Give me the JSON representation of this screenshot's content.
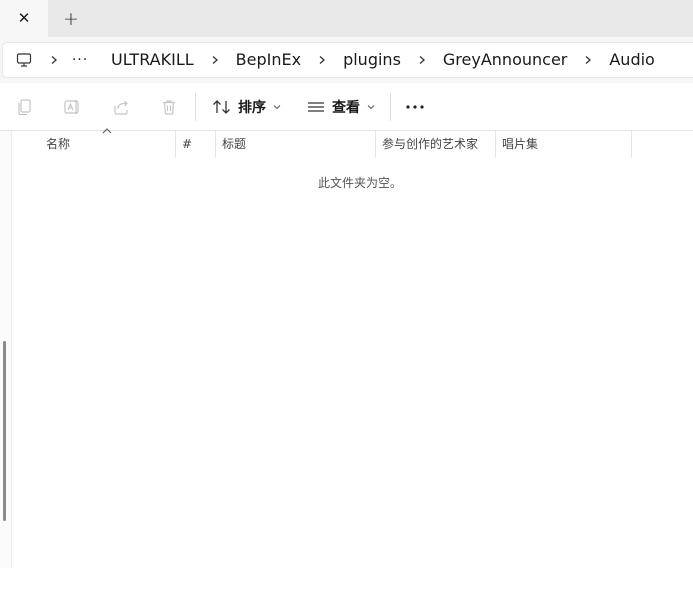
{
  "tabs": {
    "close_glyph": "✕",
    "new_tab_glyph": "+"
  },
  "breadcrumb": {
    "root_icon": "computer-icon",
    "overflow_glyph": "···",
    "items": [
      {
        "label": "ULTRAKILL"
      },
      {
        "label": "BepInEx"
      },
      {
        "label": "plugins"
      },
      {
        "label": "GreyAnnouncer"
      },
      {
        "label": "Audio"
      }
    ]
  },
  "toolbar": {
    "copy_icon": "copy-icon",
    "rename_icon": "rename-icon",
    "share_icon": "share-icon",
    "delete_icon": "delete-icon",
    "sort_label": "排序",
    "view_label": "查看",
    "more_glyph": "···"
  },
  "columns": {
    "name": "名称",
    "number": "#",
    "title": "标题",
    "artists": "参与创作的艺术家",
    "album": "唱片集"
  },
  "empty_message": "此文件夹为空。",
  "colors": {
    "disabled_icon": "#c4c4c4",
    "tab_strip": "#e9e9e9",
    "address_bg": "#f7f7f7"
  }
}
